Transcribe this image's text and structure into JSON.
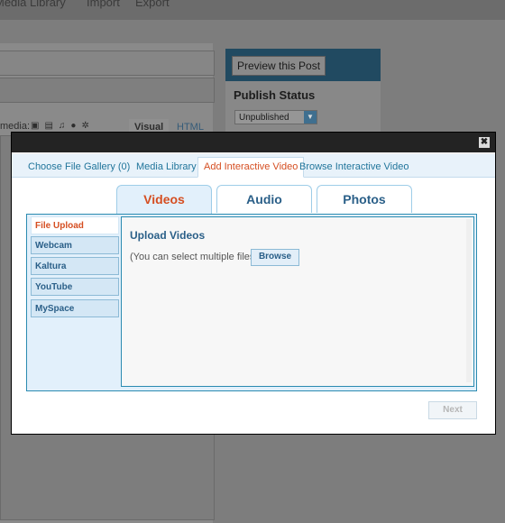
{
  "background": {
    "topnav": [
      "Media Library",
      "Import",
      "Export"
    ],
    "media_label": "media:",
    "editor_tabs": {
      "visual": "Visual",
      "html": "HTML"
    },
    "preview_button": "Preview this Post",
    "publish_status_label": "Publish Status",
    "status_select": "Unpublished"
  },
  "modal": {
    "close_glyph": "✖",
    "tabs": [
      "Choose File",
      "Gallery (0)",
      "Media Library",
      "Add Interactive Video",
      "Browse Interactive Video"
    ],
    "active_tab": "Add Interactive Video",
    "type_tabs": [
      "Videos",
      "Audio",
      "Photos"
    ],
    "active_type": "Videos",
    "sources": [
      "File Upload",
      "Webcam",
      "Kaltura",
      "YouTube",
      "MySpace"
    ],
    "active_source": "File Upload",
    "content": {
      "title": "Upload Videos",
      "note": "(You can select multiple files)",
      "browse_label": "Browse"
    },
    "next_label": "Next"
  },
  "colors": {
    "accent": "#d54e21",
    "link": "#21759b",
    "panel_border": "#2b8bb1",
    "panel_bg": "#e2f0fb"
  },
  "icons": [
    "close-icon",
    "image-icon",
    "video-icon",
    "audio-icon",
    "media-icon",
    "settings-icon"
  ]
}
